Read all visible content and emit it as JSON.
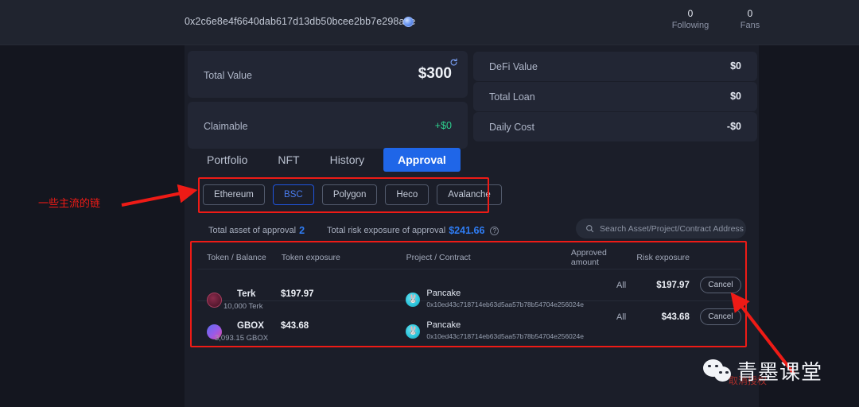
{
  "header": {
    "wallet_address": "0x2c6e8e4f6640dab617d13db50bcee2bb7e298ade",
    "address_badge_icon": "token-badge-icon",
    "stats": [
      {
        "name": "following",
        "value": "0",
        "label": "Following"
      },
      {
        "name": "fans",
        "value": "0",
        "label": "Fans"
      }
    ]
  },
  "summary_cards": {
    "total_value": {
      "label": "Total Value",
      "value": "$300",
      "refresh_icon": "refresh-icon"
    },
    "claimable": {
      "label": "Claimable",
      "value": "+$0"
    },
    "defi_value": {
      "label": "DeFi Value",
      "value": "$0"
    },
    "total_loan": {
      "label": "Total Loan",
      "value": "$0"
    },
    "daily_cost": {
      "label": "Daily Cost",
      "value": "-$0"
    }
  },
  "tabs": [
    {
      "label": "Portfolio",
      "active": false
    },
    {
      "label": "NFT",
      "active": false
    },
    {
      "label": "History",
      "active": false
    },
    {
      "label": "Approval",
      "active": true
    }
  ],
  "chains": [
    {
      "label": "Ethereum",
      "selected": false
    },
    {
      "label": "BSC",
      "selected": true
    },
    {
      "label": "Polygon",
      "selected": false
    },
    {
      "label": "Heco",
      "selected": false
    },
    {
      "label": "Avalanche",
      "selected": false
    }
  ],
  "approval_stats": {
    "asset_label": "Total asset of approval",
    "asset_value": "2",
    "risk_label": "Total risk exposure of approval",
    "risk_value": "$241.66",
    "help_icon": "question-mark-icon",
    "help_glyph": "?"
  },
  "search": {
    "placeholder": "Search Asset/Project/Contract Address",
    "value": "",
    "icon": "search-icon"
  },
  "table": {
    "columns": [
      "Token / Balance",
      "Token exposure",
      "Project / Contract",
      "Approved amount",
      "Risk exposure"
    ],
    "rows": [
      {
        "token_name": "Terk",
        "token_balance": "10,000 Terk",
        "token_exposure": "$197.97",
        "token_icon": "terk-token-icon",
        "project_name": "Pancake",
        "project_icon": "pancake-icon",
        "project_glyph": "🐰",
        "contract": "0x10ed43c718714eb63d5aa57b78b54704e256024e",
        "approved_amount": "All",
        "risk_exposure": "$197.97",
        "action_label": "Cancel"
      },
      {
        "token_name": "GBOX",
        "token_balance": "3,093.15 GBOX",
        "token_exposure": "$43.68",
        "token_icon": "gbox-token-icon",
        "project_name": "Pancake",
        "project_icon": "pancake-icon",
        "project_glyph": "🐰",
        "contract": "0x10ed43c718714eb63d5aa57b78b54704e256024e",
        "approved_amount": "All",
        "risk_exposure": "$43.68",
        "action_label": "Cancel"
      }
    ]
  },
  "annotations": {
    "chains_note": "一些主流的链",
    "cancel_note": "取消授权",
    "highlight_color": "#ee1b16"
  },
  "watermark": {
    "brand": "青墨课堂",
    "logo_icon": "wechat-icon"
  }
}
